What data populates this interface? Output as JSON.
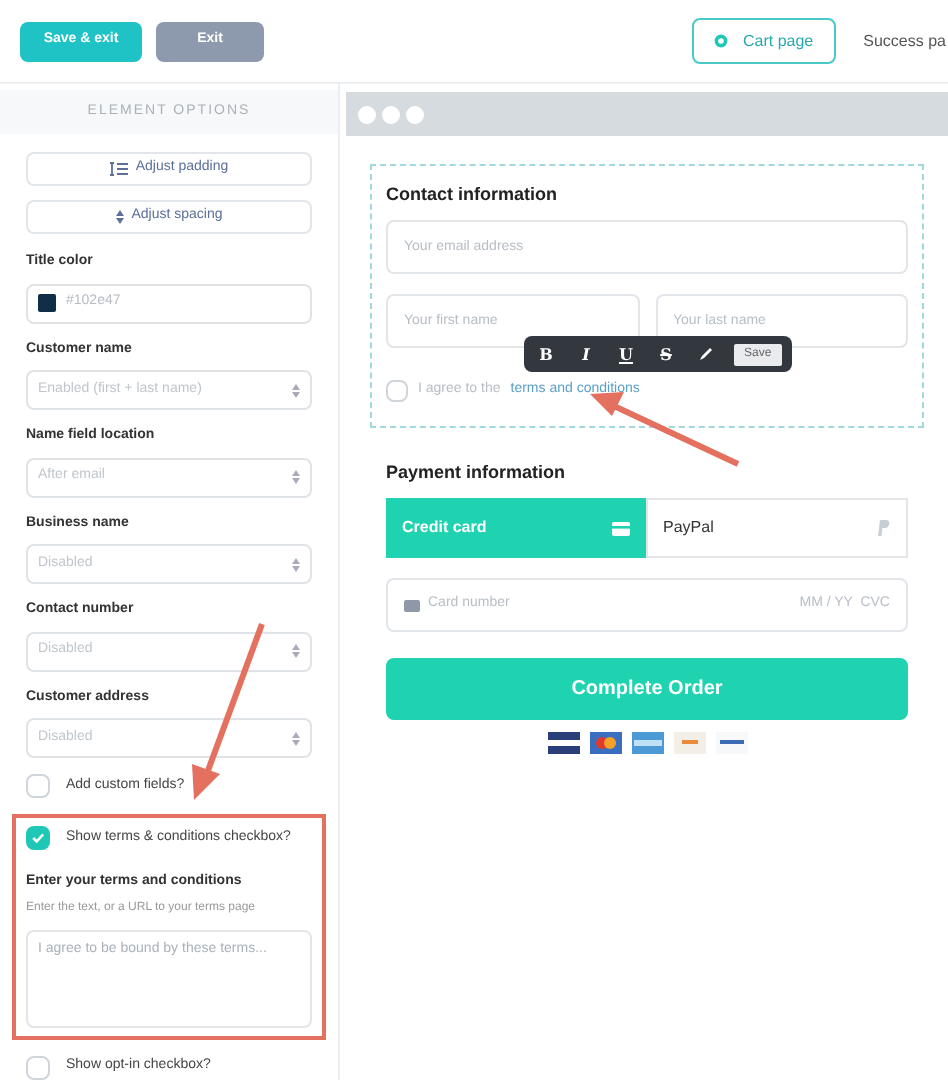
{
  "header": {
    "buttons": [
      {
        "label": "Save & exit",
        "kind": "primary"
      },
      {
        "label": "Exit",
        "kind": "secondary"
      }
    ],
    "page_tabs": [
      {
        "label": "Cart page",
        "selected": true
      },
      {
        "label": "Success pa",
        "selected": false
      }
    ]
  },
  "sidebar": {
    "title": "ELEMENT OPTIONS",
    "actions": [
      {
        "label": "Adjust padding",
        "kind": "padding"
      },
      {
        "label": "Adjust spacing",
        "kind": "spacing"
      }
    ],
    "options": [
      {
        "kind": "color",
        "label": "Title color",
        "value": "#102e47",
        "color": "#102e47"
      },
      {
        "kind": "select",
        "label": "Customer name",
        "value": "Enabled (first + last name)"
      },
      {
        "kind": "select",
        "label": "Name field location",
        "value": "After email"
      },
      {
        "kind": "select",
        "label": "Business name",
        "value": "Disabled"
      },
      {
        "kind": "select",
        "label": "Contact number",
        "value": "Disabled"
      },
      {
        "kind": "select",
        "label": "Customer address",
        "value": "Disabled"
      },
      {
        "kind": "checkbox",
        "label": "Add custom fields?",
        "checked": false
      },
      {
        "kind": "checkbox",
        "label": "Show terms & conditions checkbox?",
        "checked": true,
        "highlighted": true
      },
      {
        "kind": "textarea",
        "label": "Enter your terms and conditions",
        "hint": "Enter the text, or a URL to your terms page",
        "placeholder": "I agree to be bound by these terms...",
        "highlighted": true
      },
      {
        "kind": "checkbox",
        "label": "Show opt-in checkbox?",
        "checked": false
      }
    ]
  },
  "preview": {
    "contact": {
      "title": "Contact information",
      "email": {
        "placeholder": "Your email address"
      },
      "names": [
        {
          "placeholder": "Your first name"
        },
        {
          "placeholder": "Your last name"
        }
      ],
      "terms": {
        "checked": false,
        "text": "I agree to the",
        "link": "terms and conditions"
      },
      "toolbar": {
        "buttons": [
          {
            "kind": "bold",
            "label": "B"
          },
          {
            "kind": "italic",
            "label": "I"
          },
          {
            "kind": "underline",
            "label": "U"
          },
          {
            "kind": "strike",
            "label": "S"
          },
          {
            "kind": "pen"
          }
        ],
        "save": "Save"
      }
    },
    "payment": {
      "title": "Payment information",
      "methods": [
        {
          "label": "Credit card",
          "kind": "card",
          "selected": true
        },
        {
          "label": "PayPal",
          "kind": "paypal",
          "selected": false
        }
      ],
      "card_field": {
        "placeholder": "Card number",
        "expiry_placeholder": "MM / YY  CVC"
      },
      "submit": "Complete Order"
    }
  }
}
